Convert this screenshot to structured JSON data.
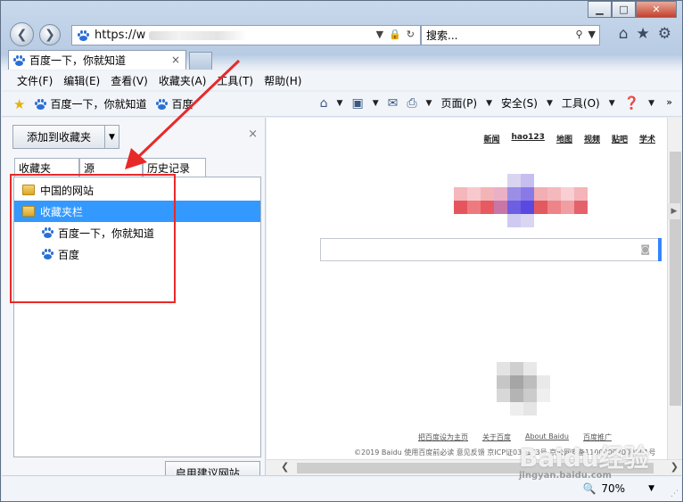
{
  "browser": {
    "address_text": "https://w",
    "search_placeholder": "搜索...",
    "tab_title": "百度一下，你就知道",
    "tab_close": "×"
  },
  "menu": [
    "文件(F)",
    "编辑(E)",
    "查看(V)",
    "收藏夹(A)",
    "工具(T)",
    "帮助(H)"
  ],
  "favorites_bar": {
    "links": [
      "百度一下，你就知道",
      "百度"
    ]
  },
  "command_bar": {
    "page": "页面(P)",
    "safety": "安全(S)",
    "tools": "工具(O)"
  },
  "favorites_pane": {
    "add_button": "添加到收藏夹",
    "close": "×",
    "tabs": [
      "收藏夹",
      "源",
      "历史记录"
    ],
    "tree": [
      {
        "label": "中国的网站",
        "type": "folder"
      },
      {
        "label": "收藏夹栏",
        "type": "folder",
        "selected": true
      },
      {
        "label": "百度一下，你就知道",
        "type": "link"
      },
      {
        "label": "百度",
        "type": "link"
      }
    ],
    "suggest_button": "启用建议网站..."
  },
  "page": {
    "top_links": [
      "新闻",
      "hao123",
      "地图",
      "视频",
      "贴吧",
      "学术"
    ],
    "footer_links": [
      "把百度设为主页",
      "关于百度",
      "About  Baidu",
      "百度推广"
    ],
    "footer_copyright": "©2019 Baidu 使用百度前必读 意见反馈 京ICP证030173号 京公网安备11000002000001号"
  },
  "status": {
    "zoom": "70%"
  },
  "watermark": {
    "text": "Baidu经验",
    "sub": "jingyan.baidu.com"
  },
  "colors": {
    "selection": "#3399ff",
    "annotation": "#e82929",
    "baidu_blue": "#2a6fd6"
  }
}
